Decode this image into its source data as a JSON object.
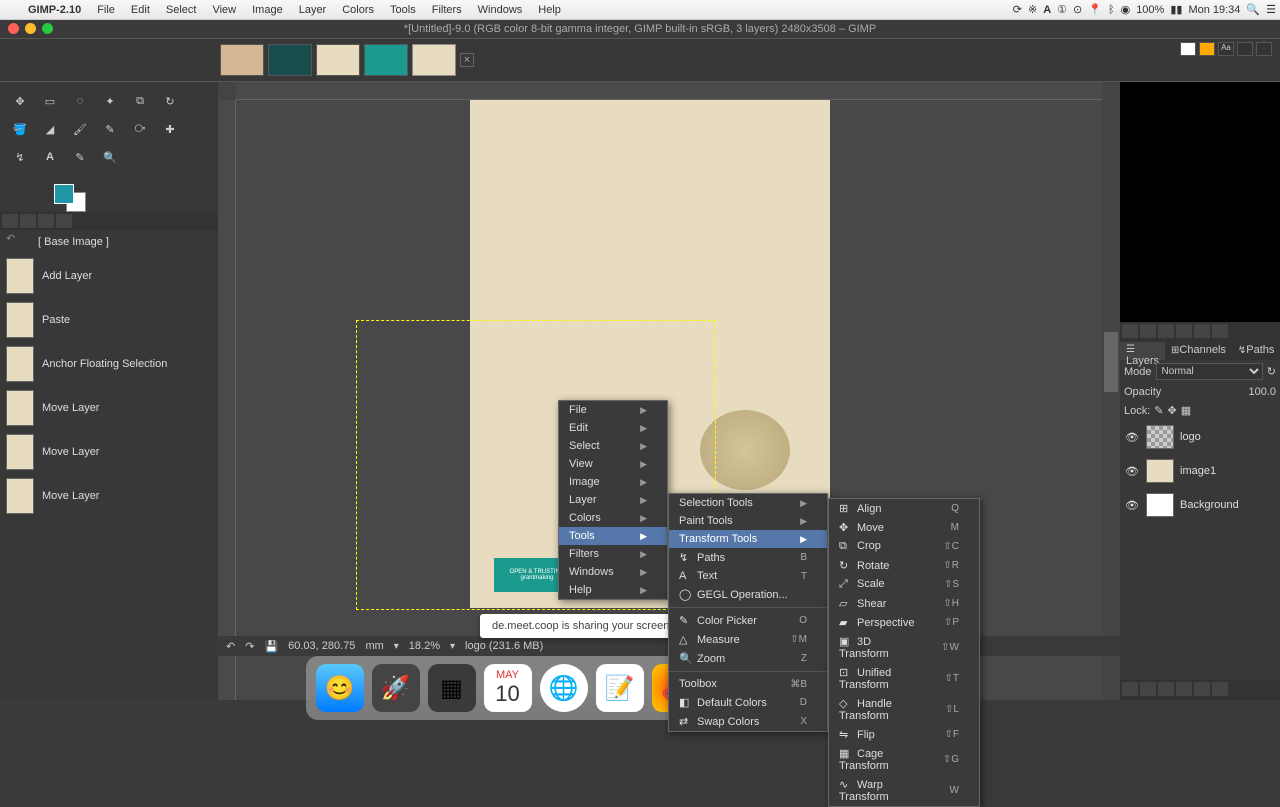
{
  "menubar": {
    "app": "GIMP-2.10",
    "items": [
      "File",
      "Edit",
      "Select",
      "View",
      "Image",
      "Layer",
      "Colors",
      "Tools",
      "Filters",
      "Windows",
      "Help"
    ],
    "battery": "100%",
    "time": "Mon 19:34"
  },
  "title": "*[Untitled]-9.0 (RGB color 8-bit gamma integer, GIMP built-in sRGB, 3 layers) 2480x3508 – GIMP",
  "undo_history": [
    {
      "label": "[ Base Image ]",
      "base": true
    },
    {
      "label": "Add Layer"
    },
    {
      "label": "Paste"
    },
    {
      "label": "Anchor Floating Selection"
    },
    {
      "label": "Move Layer"
    },
    {
      "label": "Move Layer"
    },
    {
      "label": "Move Layer"
    }
  ],
  "context_menu_1": [
    "File",
    "Edit",
    "Select",
    "View",
    "Image",
    "Layer",
    "Colors",
    "Tools",
    "Filters",
    "Windows",
    "Help"
  ],
  "context_menu_2": {
    "items": [
      {
        "label": "Selection Tools",
        "arrow": true
      },
      {
        "label": "Paint Tools",
        "arrow": true
      },
      {
        "label": "Transform Tools",
        "arrow": true,
        "hl": true
      },
      {
        "label": "Paths",
        "shortcut": "B",
        "icon": "↯"
      },
      {
        "label": "Text",
        "shortcut": "T",
        "icon": "A"
      },
      {
        "label": "GEGL Operation...",
        "icon": "◯"
      }
    ],
    "items2": [
      {
        "label": "Color Picker",
        "shortcut": "O",
        "icon": "✎"
      },
      {
        "label": "Measure",
        "shortcut": "⇧M",
        "icon": "△"
      },
      {
        "label": "Zoom",
        "shortcut": "Z",
        "icon": "🔍"
      }
    ],
    "items3": [
      {
        "label": "Toolbox",
        "shortcut": "⌘B"
      },
      {
        "label": "Default Colors",
        "shortcut": "D",
        "icon": "◧"
      },
      {
        "label": "Swap Colors",
        "shortcut": "X",
        "icon": "⇄"
      }
    ]
  },
  "context_menu_3": [
    {
      "label": "Align",
      "shortcut": "Q",
      "icon": "⊞"
    },
    {
      "label": "Move",
      "shortcut": "M",
      "icon": "✥"
    },
    {
      "label": "Crop",
      "shortcut": "⇧C",
      "icon": "⧉"
    },
    {
      "label": "Rotate",
      "shortcut": "⇧R",
      "icon": "↻"
    },
    {
      "label": "Scale",
      "shortcut": "⇧S",
      "icon": "⤢"
    },
    {
      "label": "Shear",
      "shortcut": "⇧H",
      "icon": "▱"
    },
    {
      "label": "Perspective",
      "shortcut": "⇧P",
      "icon": "▰"
    },
    {
      "label": "3D Transform",
      "shortcut": "⇧W",
      "icon": "▣"
    },
    {
      "label": "Unified Transform",
      "shortcut": "⇧T",
      "icon": "⊡"
    },
    {
      "label": "Handle Transform",
      "shortcut": "⇧L",
      "icon": "◇"
    },
    {
      "label": "Flip",
      "shortcut": "⇧F",
      "icon": "⇋"
    },
    {
      "label": "Cage Transform",
      "shortcut": "⇧G",
      "icon": "▦"
    },
    {
      "label": "Warp Transform",
      "shortcut": "W",
      "icon": "∿"
    }
  ],
  "layers": {
    "mode_label": "Mode",
    "mode_value": "Normal",
    "opacity_label": "Opacity",
    "opacity_value": "100.0",
    "lock_label": "Lock:",
    "tabs": [
      "Layers",
      "Channels",
      "Paths"
    ],
    "items": [
      {
        "name": "logo",
        "thumb": "#ccc"
      },
      {
        "name": "image1",
        "thumb": "#e8dcc0"
      },
      {
        "name": "Background",
        "thumb": "#fff"
      }
    ]
  },
  "status": {
    "coords": "60.03, 280.75",
    "unit": "mm",
    "zoom": "18.2%",
    "info": "logo (231.6 MB)"
  },
  "share_msg": "de.meet.coop is sharing your screen",
  "teal_label": "OPEN & TRUSTING\ngrantmaking",
  "dock_date": {
    "month": "MAY",
    "day": "10"
  }
}
